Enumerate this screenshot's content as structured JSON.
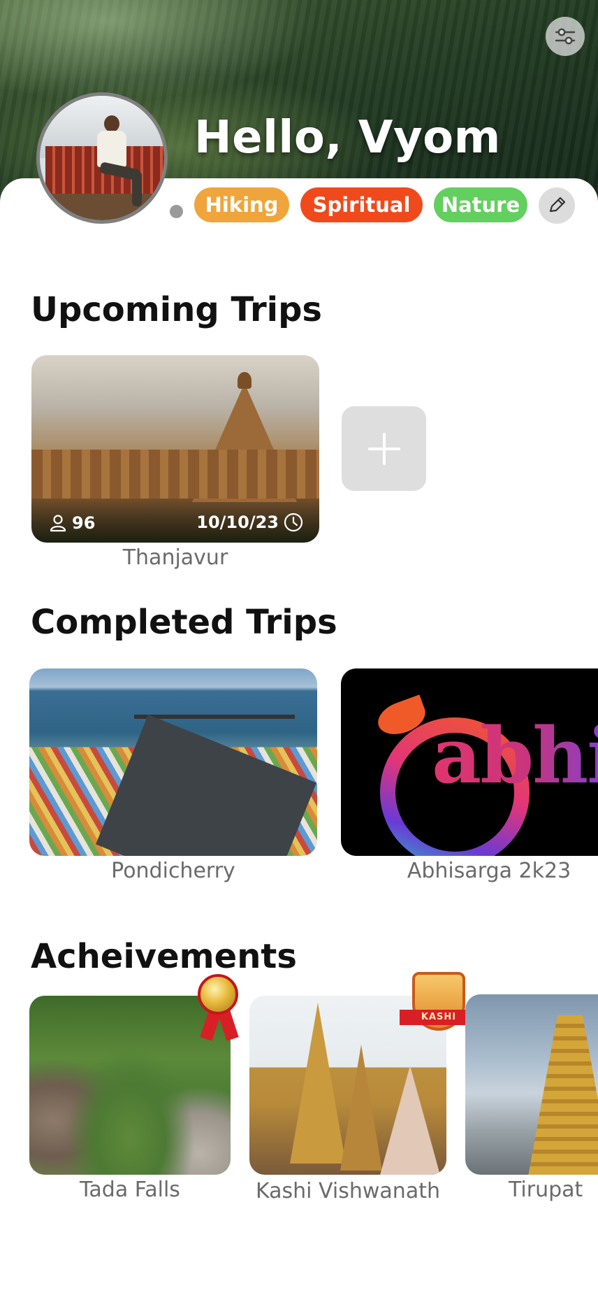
{
  "header": {
    "greeting": "Hello,  Vyom",
    "tags": [
      {
        "label": "Hiking",
        "color": "#efa53b"
      },
      {
        "label": "Spiritual",
        "color": "#f04a1c"
      },
      {
        "label": "Nature",
        "color": "#63cf5f"
      }
    ],
    "icons": {
      "filter": "sliders-icon",
      "edit": "pencil-icon",
      "status": "status-dot"
    }
  },
  "upcoming": {
    "title": "Upcoming Trips",
    "trips": [
      {
        "name": "Thanjavur",
        "members": "96",
        "date": "10/10/23"
      }
    ],
    "add_icon": "plus-icon"
  },
  "completed": {
    "title": "Completed Trips",
    "trips": [
      {
        "name": "Pondicherry"
      },
      {
        "name": "Abhisarga 2k23",
        "logo_text": "abhisa"
      }
    ]
  },
  "achievements": {
    "title": "Acheivements",
    "items": [
      {
        "name": "Tada Falls",
        "badge": "medal-badge"
      },
      {
        "name": "Kashi Vishwanath",
        "badge": "kashi-badge",
        "badge_text": "KASHI"
      },
      {
        "name": "Tirupat"
      }
    ]
  }
}
